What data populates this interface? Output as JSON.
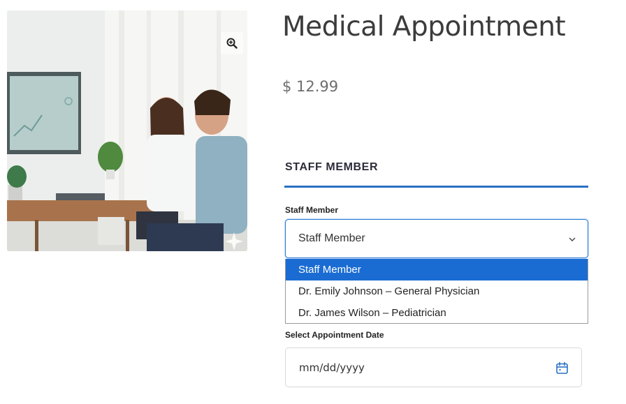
{
  "product": {
    "title": "Medical Appointment",
    "price": "$ 12.99",
    "image_icon": "zoom-in-icon"
  },
  "booking": {
    "section_heading": "STAFF MEMBER",
    "staff_label": "Staff Member",
    "staff_selected": "Staff Member",
    "staff_options": [
      "Staff Member",
      "Dr. Emily Johnson – General Physician",
      "Dr. James Wilson – Pediatrician"
    ],
    "date_label": "Select Appointment Date",
    "date_placeholder": "mm/dd/yyyy",
    "date_icon": "calendar-icon"
  },
  "colors": {
    "accent": "#2a71c4",
    "option_highlight": "#1a6cd3"
  }
}
